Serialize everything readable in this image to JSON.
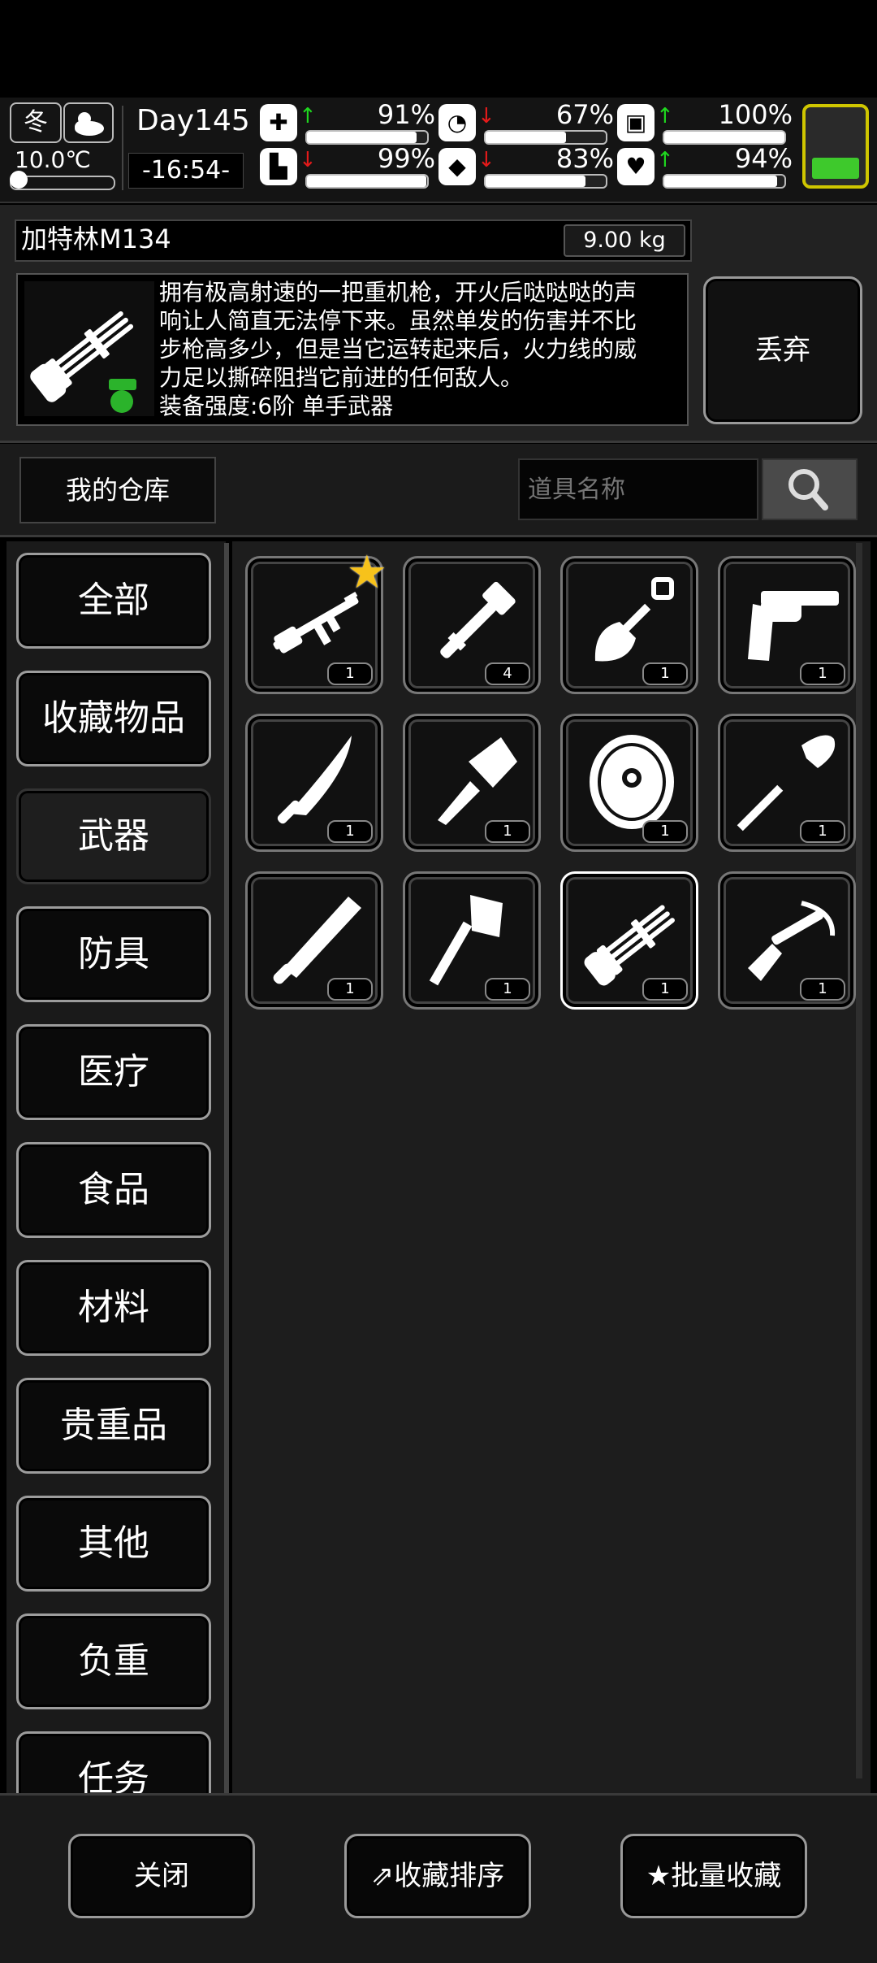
{
  "hud": {
    "season": "冬",
    "temperature": "10.0℃",
    "day": "Day145",
    "time": "-16:54-",
    "stats": [
      {
        "icon": "medkit-icon",
        "glyph": "✚",
        "trend": "up",
        "value": "91%",
        "level": 0.91
      },
      {
        "icon": "stomach-icon",
        "glyph": "◔",
        "trend": "down",
        "value": "67%",
        "level": 0.67
      },
      {
        "icon": "battery-icon",
        "glyph": "▣",
        "trend": "up",
        "value": "100%",
        "level": 1.0
      },
      {
        "icon": "foot-icon",
        "glyph": "▙",
        "trend": "down",
        "value": "99%",
        "level": 0.99
      },
      {
        "icon": "water-drop-icon",
        "glyph": "◆",
        "trend": "down",
        "value": "83%",
        "level": 0.83
      },
      {
        "icon": "heart-icon",
        "glyph": "♥",
        "trend": "up",
        "value": "94%",
        "level": 0.94
      }
    ],
    "energy_level": 0.3
  },
  "item": {
    "name": "加特林M134",
    "weight": "9.00 kg",
    "description_lines": [
      "拥有极高射速的一把重机枪，开火后哒哒哒的声",
      "响让人简直无法停下来。虽然单发的伤害并不比",
      "步枪高多少，但是当它运转起来后，火力线的威",
      "力足以撕碎阻挡它前进的任何敌人。",
      "装备强度:6阶 单手武器"
    ],
    "discard_label": "丢弃"
  },
  "search": {
    "warehouse_label": "我的仓库",
    "placeholder": "道具名称"
  },
  "categories": [
    "全部",
    "收藏物品",
    "武器",
    "防具",
    "医疗",
    "食品",
    "材料",
    "贵重品",
    "其他",
    "负重",
    "任务"
  ],
  "selected_category": "武器",
  "items": [
    {
      "name": "assault-rifle-icon",
      "count": "1",
      "favorite": true
    },
    {
      "name": "pipe-wrench-icon",
      "count": "4"
    },
    {
      "name": "shovel-icon",
      "count": "1"
    },
    {
      "name": "revolver-icon",
      "count": "1"
    },
    {
      "name": "curved-knife-icon",
      "count": "1"
    },
    {
      "name": "cleaver-axe-icon",
      "count": "1"
    },
    {
      "name": "shield-icon",
      "count": "1"
    },
    {
      "name": "spade-icon",
      "count": "1"
    },
    {
      "name": "machete-icon",
      "count": "1"
    },
    {
      "name": "hatchet-icon",
      "count": "1"
    },
    {
      "name": "minigun-icon",
      "count": "1",
      "selected": true
    },
    {
      "name": "crossbow-icon",
      "count": "1"
    }
  ],
  "bottom": {
    "close_label": "关闭",
    "sort_label": "收藏排序",
    "batch_label": "批量收藏"
  }
}
